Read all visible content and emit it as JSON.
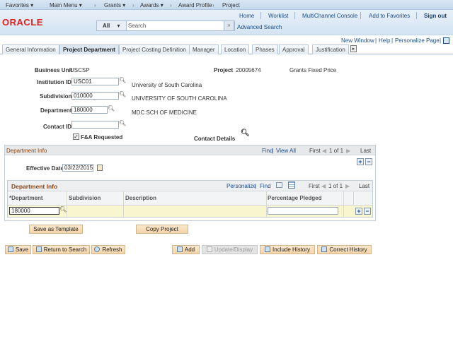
{
  "nav": {
    "favorites": "Favorites ▾",
    "main_menu": "Main Menu ▾",
    "crumbs": [
      "Grants ▾",
      "Awards ▾",
      "Award Profile",
      "Project"
    ],
    "sep": "›"
  },
  "header": {
    "logo": "ORACLE",
    "links": [
      "Home",
      "Worklist",
      "MultiChannel Console",
      "Add to Favorites",
      "Sign out"
    ],
    "search_scope": "All",
    "search_placeholder": "Search",
    "search_go": "»",
    "advanced_search": "Advanced Search"
  },
  "util": {
    "new_window": "New Window",
    "help": "Help",
    "personalize": "Personalize Page"
  },
  "tabs": [
    "General Information",
    "Project Department",
    "Project Costing Definition",
    "Manager",
    "Location",
    "Phases",
    "Approval",
    "Justification"
  ],
  "form": {
    "business_unit_label": "Business Unit",
    "business_unit": "USCSP",
    "project_label": "Project",
    "project": "20005674",
    "project_type": "Grants Fixed Price",
    "institution_label": "Institution ID",
    "institution": "USC01",
    "institution_desc": "University of South Carolina",
    "subdivision_label": "Subdivision",
    "subdivision": "010000",
    "subdivision_desc": "UNIVERSITY OF SOUTH CAROLINA",
    "department_label": "Department",
    "department": "180000",
    "department_desc": "MDC SCH OF MEDICINE",
    "contact_label": "Contact ID",
    "contact": "",
    "fa_label": "F&A Requested",
    "fa_checked": true,
    "contact_details": "Contact Details"
  },
  "dept_info": {
    "title": "Department Info",
    "find": "Find",
    "view_all": "View All",
    "first": "First",
    "count": "1 of 1",
    "last": "Last",
    "eff_date_label": "Effective Date",
    "eff_date": "03/22/2015"
  },
  "grid": {
    "title": "Department Info",
    "personalize": "Personalize",
    "find": "Find",
    "first": "First",
    "count": "1 of 1",
    "last": "Last",
    "columns": [
      "*Department",
      "Subdivision",
      "Description",
      "Percentage Pledged"
    ],
    "rows": [
      {
        "department": "180000",
        "subdivision": "",
        "description": "",
        "pledged": ""
      }
    ]
  },
  "buttons": {
    "save_template": "Save as Template",
    "copy_project": "Copy Project",
    "save": "Save",
    "return": "Return to Search",
    "refresh": "Refresh",
    "add": "Add",
    "update": "Update/Display",
    "include": "Include History",
    "correct": "Correct History"
  }
}
